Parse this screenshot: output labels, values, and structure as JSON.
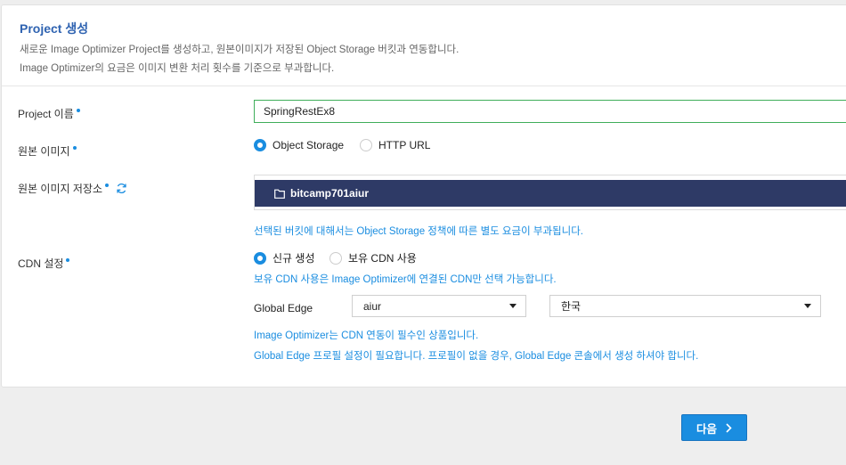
{
  "header": {
    "title": "Project 생성",
    "desc_line1": "새로운 Image Optimizer Project를 생성하고, 원본이미지가 저장된 Object Storage 버킷과 연동합니다.",
    "desc_line2": "Image Optimizer의 요금은 이미지 변환 처리 횟수를 기준으로 부과합니다."
  },
  "form": {
    "project_name_label": "Project 이름",
    "project_name_value": "SpringRestEx8",
    "source_image_label": "원본 이미지",
    "source_options": [
      "Object Storage",
      "HTTP URL"
    ],
    "source_selected": "Object Storage",
    "storage_label": "원본 이미지 저장소",
    "bucket_name": "bitcamp701aiur",
    "bucket_notice": "선택된 버킷에 대해서는 Object Storage 정책에 따른 별도 요금이 부과됩니다.",
    "cdn_label": "CDN 설정",
    "cdn_options": [
      "신규 생성",
      "보유 CDN 사용"
    ],
    "cdn_selected": "신규 생성",
    "cdn_notice": "보유 CDN 사용은 Image Optimizer에 연결된 CDN만 선택 가능합니다.",
    "global_edge_label": "Global Edge",
    "edge_select_1": "aiur",
    "edge_select_2": "한국",
    "cdn_info_1": "Image Optimizer는 CDN 연동이 필수인 상품입니다.",
    "cdn_info_2": "Global Edge 프로필 설정이 필요합니다. 프로필이 없을 경우, Global Edge 콘솔에서 생성 하셔야 합니다."
  },
  "footer": {
    "next_label": "다음"
  },
  "colors": {
    "accent": "#1a8de0",
    "title": "#2f63b1",
    "bucket_bg": "#2e3a66",
    "input_border": "#3fae5a"
  }
}
